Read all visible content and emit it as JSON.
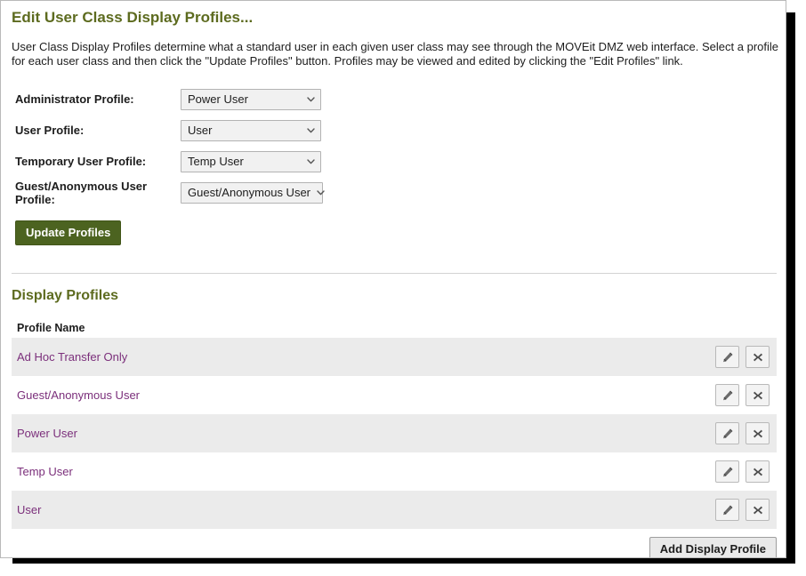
{
  "page": {
    "title": "Edit User Class Display Profiles...",
    "intro": "User Class Display Profiles determine what a standard user in each given user class may see through the MOVEit DMZ web interface. Select a profile for each user class and then click the \"Update Profiles\" button. Profiles may be viewed and edited by clicking the \"Edit Profiles\" link."
  },
  "form": {
    "rows": [
      {
        "label": "Administrator Profile:",
        "value": "Power User"
      },
      {
        "label": "User Profile:",
        "value": "User"
      },
      {
        "label": "Temporary User Profile:",
        "value": "Temp User"
      },
      {
        "label": "Guest/Anonymous User Profile:",
        "value": "Guest/Anonymous User"
      }
    ],
    "submit_label": "Update Profiles"
  },
  "profiles_section": {
    "title": "Display Profiles",
    "column_header": "Profile Name",
    "rows": [
      {
        "name": "Ad Hoc Transfer Only"
      },
      {
        "name": "Guest/Anonymous User"
      },
      {
        "name": "Power User"
      },
      {
        "name": "Temp User"
      },
      {
        "name": "User"
      }
    ],
    "add_label": "Add Display Profile",
    "edit_icon": "pencil-icon",
    "delete_icon": "close-x-icon"
  },
  "colors": {
    "heading_green": "#5d6b1f",
    "button_green": "#4c6320",
    "link_purple": "#7b2f7b",
    "row_stripe": "#ebebeb"
  }
}
